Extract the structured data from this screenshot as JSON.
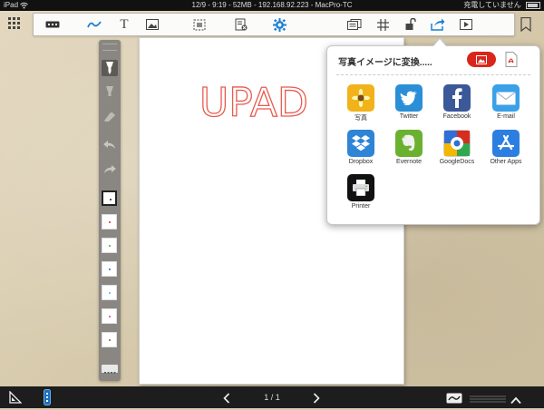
{
  "status_bar": {
    "device": "iPad",
    "center": "12/9 - 9:19 - 52MB - 192.168.92.223 - MacPro-TC",
    "battery_text": "充電していません"
  },
  "toolbar": {
    "items": [
      "apps-grid-icon",
      "keyboard-icon",
      "pen-icon",
      "text-icon",
      "image-icon",
      "selection-icon",
      "clear-page-icon",
      "settings-icon",
      "templates-icon",
      "grid-icon",
      "lock-icon",
      "share-icon",
      "slideshow-icon",
      "bookmark-icon"
    ],
    "text_tool_glyph": "T"
  },
  "page": {
    "handwriting": "UPAD",
    "ink_color": "#e85a4f"
  },
  "palette": {
    "swatch_colors": [
      "#222222",
      "#d7262a",
      "#4aa84b",
      "#2b64c8",
      "#4ab9d9",
      "#d43d8f",
      "#8a5a3a"
    ],
    "selected_swatch": 0
  },
  "share_popover": {
    "title": "写真イメージに変換.....",
    "apps": [
      {
        "label": "写真",
        "icon": "photos-icon",
        "color": "#f2b21a"
      },
      {
        "label": "Twitter",
        "icon": "twitter-icon",
        "color": "#2a8fd6"
      },
      {
        "label": "Facebook",
        "icon": "facebook-icon",
        "color": "#3b5998"
      },
      {
        "label": "E-mail",
        "icon": "email-icon",
        "color": "#3aa0e8"
      },
      {
        "label": "Dropbox",
        "icon": "dropbox-icon",
        "color": "#2f84d6"
      },
      {
        "label": "Evernote",
        "icon": "evernote-icon",
        "color": "#6bb130"
      },
      {
        "label": "GoogleDocs",
        "icon": "googledocs-icon",
        "color": "#2f6fd6"
      },
      {
        "label": "Other Apps",
        "icon": "appstore-icon",
        "color": "#2c7fe0"
      },
      {
        "label": "Printer",
        "icon": "printer-icon",
        "color": "#111111"
      }
    ]
  },
  "bottom_bar": {
    "page_indicator": "1 / 1"
  }
}
